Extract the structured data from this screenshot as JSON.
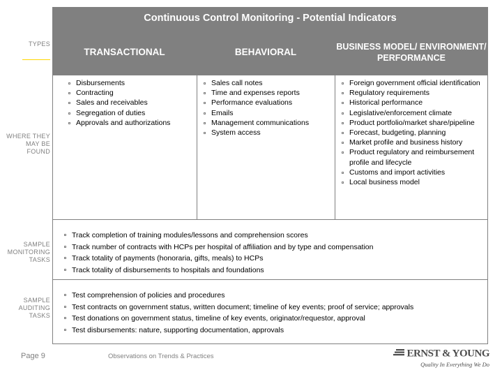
{
  "slide": {
    "title": "Continuous Control Monitoring - Potential Indicators",
    "row_labels": {
      "types": "TYPES",
      "where_they_may_be_found": "WHERE THEY\nMAY BE\nFOUND",
      "sample_monitoring_tasks": "SAMPLE\nMONITORING\nTASKS",
      "sample_auditing_tasks": "SAMPLE\nAUDITING\nTASKS"
    },
    "columns": [
      {
        "header": "TRANSACTIONAL",
        "items": [
          "Disbursements",
          "Contracting",
          "Sales and receivables",
          "Segregation of duties",
          "Approvals and authorizations"
        ]
      },
      {
        "header": "BEHAVIORAL",
        "items": [
          "Sales call notes",
          "Time and expenses reports",
          "Performance evaluations",
          "Emails",
          "Management communications",
          "System access"
        ]
      },
      {
        "header": "BUSINESS MODEL/ ENVIRONMENT/ PERFORMANCE",
        "items": [
          "Foreign government official identification",
          "Regulatory requirements",
          "Historical performance",
          "Legislative/enforcement climate",
          "Product portfolio/market share/pipeline",
          "Forecast, budgeting, planning",
          "Market profile and business history",
          "Product regulatory and reimbursement profile and lifecycle",
          "Customs and import activities",
          "Local business model"
        ]
      }
    ],
    "monitoring_tasks": [
      "Track completion of training modules/lessons and comprehension scores",
      "Track number of contracts with HCPs per hospital of affiliation and by type and compensation",
      "Track totality of payments (honoraria, gifts, meals) to HCPs",
      "Track totality of disbursements to hospitals and foundations"
    ],
    "auditing_tasks": [
      "Test comprehension of policies and procedures",
      "Test contracts on government status, written document; timeline of key events; proof of service; approvals",
      "Test donations on government status, timeline of key events, originator/requestor, approval",
      "Test disbursements: nature, supporting documentation, approvals"
    ],
    "footer": {
      "page": "Page 9",
      "center": "Observations on Trends & Practices",
      "logo_name": "ERNST & YOUNG",
      "logo_tagline": "Quality In Everything We Do"
    },
    "colors": {
      "header_band": "#808080",
      "accent": "#ffd700",
      "text": "#000000"
    }
  }
}
